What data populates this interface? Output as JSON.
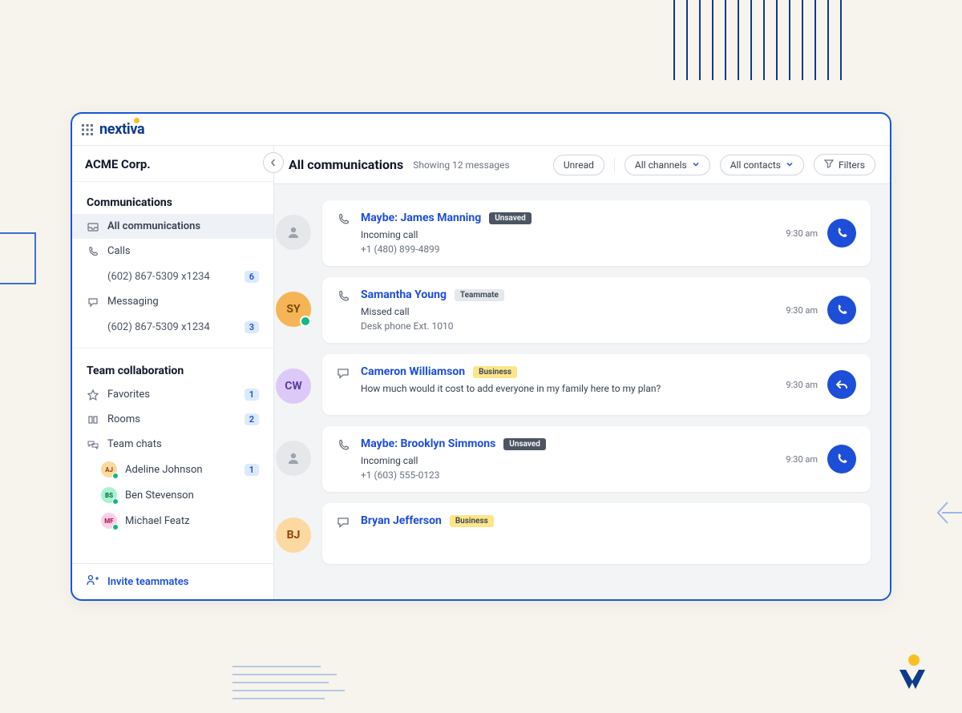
{
  "brand": "nextiva",
  "org": "ACME Corp.",
  "sidebar": {
    "sections": {
      "communications": {
        "title": "Communications",
        "all": "All communications",
        "calls": "Calls",
        "calls_number": "(602) 867-5309 x1234",
        "calls_badge": "6",
        "messaging": "Messaging",
        "messaging_number": "(602) 867-5309 x1234",
        "messaging_badge": "3"
      },
      "team": {
        "title": "Team collaboration",
        "favorites": "Favorites",
        "favorites_badge": "1",
        "rooms": "Rooms",
        "rooms_badge": "2",
        "team_chats": "Team chats",
        "members": [
          {
            "initials": "AJ",
            "name": "Adeline Johnson",
            "badge": "1",
            "bg": "#fcd9a0",
            "fg": "#92400e"
          },
          {
            "initials": "BS",
            "name": "Ben Stevenson",
            "badge": "",
            "bg": "#a7f3d0",
            "fg": "#065f46"
          },
          {
            "initials": "MF",
            "name": "Michael Featz",
            "badge": "",
            "bg": "#fbcfe8",
            "fg": "#9d174d"
          }
        ]
      }
    },
    "invite": "Invite teammates"
  },
  "header": {
    "title": "All communications",
    "subtitle": "Showing 12 messages",
    "unread": "Unread",
    "channels": "All channels",
    "contacts": "All contacts",
    "filters": "Filters"
  },
  "communications": [
    {
      "avatar_type": "placeholder",
      "avatar_initials": "",
      "avatar_bg": "#e5e7eb",
      "avatar_fg": "#9ca3af",
      "icon": "phone",
      "name": "Maybe: James Manning",
      "tag": "Unsaved",
      "tag_class": "unsaved",
      "line1": "Incoming call",
      "line2": "+1 (480) 899-4899",
      "time": "9:30 am",
      "action_icon": "phone"
    },
    {
      "avatar_type": "initials",
      "avatar_initials": "SY",
      "avatar_bg": "#f5b556",
      "avatar_fg": "#7c4a00",
      "presence": "#10b981",
      "icon": "phone",
      "name": "Samantha Young",
      "tag": "Teammate",
      "tag_class": "teammate",
      "line1": "Missed call",
      "line2": "Desk phone Ext. 1010",
      "time": "9:30 am",
      "action_icon": "phone"
    },
    {
      "avatar_type": "initials",
      "avatar_initials": "CW",
      "avatar_bg": "#ddc9f7",
      "avatar_fg": "#5b3a9b",
      "icon": "chat",
      "name": "Cameron Williamson",
      "tag": "Business",
      "tag_class": "business",
      "line1": "How much would it cost to add everyone in my family here to my plan?",
      "line2": "",
      "time": "9:30 am",
      "action_icon": "reply"
    },
    {
      "avatar_type": "placeholder",
      "avatar_initials": "",
      "avatar_bg": "#e5e7eb",
      "avatar_fg": "#9ca3af",
      "icon": "phone",
      "name": "Maybe: Brooklyn Simmons",
      "tag": "Unsaved",
      "tag_class": "unsaved",
      "line1": "Incoming call",
      "line2": "+1 (603) 555-0123",
      "time": "9:30 am",
      "action_icon": "phone"
    },
    {
      "avatar_type": "initials",
      "avatar_initials": "BJ",
      "avatar_bg": "#fcd9a0",
      "avatar_fg": "#92400e",
      "icon": "chat",
      "name": "Bryan Jefferson",
      "tag": "Business",
      "tag_class": "business",
      "line1": "",
      "line2": "",
      "time": "",
      "action_icon": ""
    }
  ]
}
